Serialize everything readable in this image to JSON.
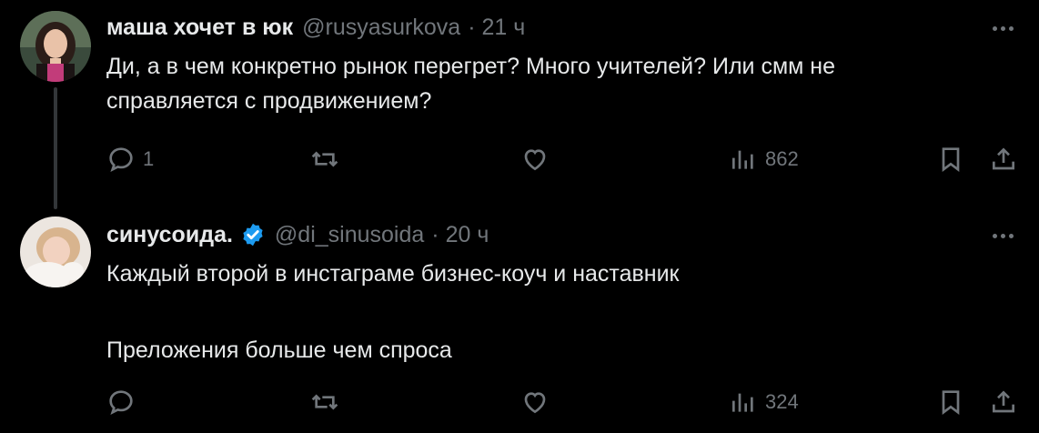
{
  "tweets": [
    {
      "name": "маша хочет в юк",
      "handle": "@rusyasurkova",
      "time": "· 21 ч",
      "verified": false,
      "text_lines": [
        "Ди, а в чем конкретно рынок перегрет? Много учителей? Или смм не",
        "справляется с продвижением?"
      ],
      "replies": "1",
      "retweets": "",
      "likes": "",
      "views": "862"
    },
    {
      "name": "синусоида.",
      "handle": "@di_sinusoida",
      "time": "· 20 ч",
      "verified": true,
      "text_lines": [
        "Каждый второй в инстаграме бизнес-коуч и наставник",
        "",
        "Преложения больше чем спроса"
      ],
      "replies": "",
      "retweets": "",
      "likes": "",
      "views": "324"
    }
  ],
  "icons": {
    "reply": "reply-icon",
    "retweet": "retweet-icon",
    "like": "heart-icon",
    "views": "views-icon",
    "bookmark": "bookmark-icon",
    "share": "share-icon",
    "more": "more-icon",
    "verified": "verified-badge-icon"
  },
  "colors": {
    "background": "#000000",
    "text": "#e7e9ea",
    "muted": "#71767b",
    "verified": "#1d9bf0",
    "thread_line": "#333639"
  }
}
